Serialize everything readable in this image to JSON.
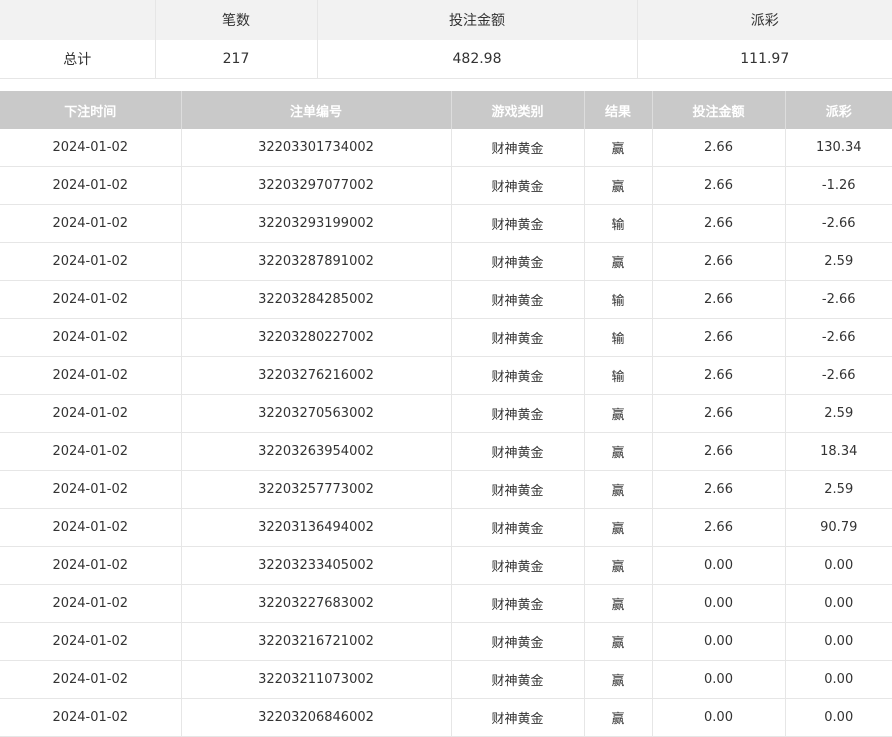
{
  "summary": {
    "headers": [
      "",
      "笔数",
      "投注金额",
      "派彩"
    ],
    "row": {
      "label": "总计",
      "count": "217",
      "bet": "482.98",
      "payout": "111.97"
    }
  },
  "table": {
    "headers": [
      "下注时间",
      "注单编号",
      "游戏类别",
      "结果",
      "投注金额",
      "派彩"
    ],
    "rows": [
      {
        "time": "2024-01-02",
        "id": "32203301734002",
        "game": "财神黄金",
        "result": "赢",
        "bet": "2.66",
        "payout": "130.34",
        "negative": false
      },
      {
        "time": "2024-01-02",
        "id": "32203297077002",
        "game": "财神黄金",
        "result": "赢",
        "bet": "2.66",
        "payout": "-1.26",
        "negative": true
      },
      {
        "time": "2024-01-02",
        "id": "32203293199002",
        "game": "财神黄金",
        "result": "输",
        "bet": "2.66",
        "payout": "-2.66",
        "negative": true
      },
      {
        "time": "2024-01-02",
        "id": "32203287891002",
        "game": "财神黄金",
        "result": "赢",
        "bet": "2.66",
        "payout": "2.59",
        "negative": false
      },
      {
        "time": "2024-01-02",
        "id": "32203284285002",
        "game": "财神黄金",
        "result": "输",
        "bet": "2.66",
        "payout": "-2.66",
        "negative": true
      },
      {
        "time": "2024-01-02",
        "id": "32203280227002",
        "game": "财神黄金",
        "result": "输",
        "bet": "2.66",
        "payout": "-2.66",
        "negative": true
      },
      {
        "time": "2024-01-02",
        "id": "32203276216002",
        "game": "财神黄金",
        "result": "输",
        "bet": "2.66",
        "payout": "-2.66",
        "negative": true
      },
      {
        "time": "2024-01-02",
        "id": "32203270563002",
        "game": "财神黄金",
        "result": "赢",
        "bet": "2.66",
        "payout": "2.59",
        "negative": false
      },
      {
        "time": "2024-01-02",
        "id": "32203263954002",
        "game": "财神黄金",
        "result": "赢",
        "bet": "2.66",
        "payout": "18.34",
        "negative": false
      },
      {
        "time": "2024-01-02",
        "id": "32203257773002",
        "game": "财神黄金",
        "result": "赢",
        "bet": "2.66",
        "payout": "2.59",
        "negative": false
      },
      {
        "time": "2024-01-02",
        "id": "32203136494002",
        "game": "财神黄金",
        "result": "赢",
        "bet": "2.66",
        "payout": "90.79",
        "negative": false
      },
      {
        "time": "2024-01-02",
        "id": "32203233405002",
        "game": "财神黄金",
        "result": "赢",
        "bet": "0.00",
        "payout": "0.00",
        "negative": false
      },
      {
        "time": "2024-01-02",
        "id": "32203227683002",
        "game": "财神黄金",
        "result": "赢",
        "bet": "0.00",
        "payout": "0.00",
        "negative": false
      },
      {
        "time": "2024-01-02",
        "id": "32203216721002",
        "game": "财神黄金",
        "result": "赢",
        "bet": "0.00",
        "payout": "0.00",
        "negative": false
      },
      {
        "time": "2024-01-02",
        "id": "32203211073002",
        "game": "财神黄金",
        "result": "赢",
        "bet": "0.00",
        "payout": "0.00",
        "negative": false
      },
      {
        "time": "2024-01-02",
        "id": "32203206846002",
        "game": "财神黄金",
        "result": "赢",
        "bet": "0.00",
        "payout": "0.00",
        "negative": false
      }
    ]
  },
  "colors": {
    "negative": "#e5404a",
    "header_bg": "#c9c9c9",
    "summary_header_bg": "#f2f2f2"
  }
}
